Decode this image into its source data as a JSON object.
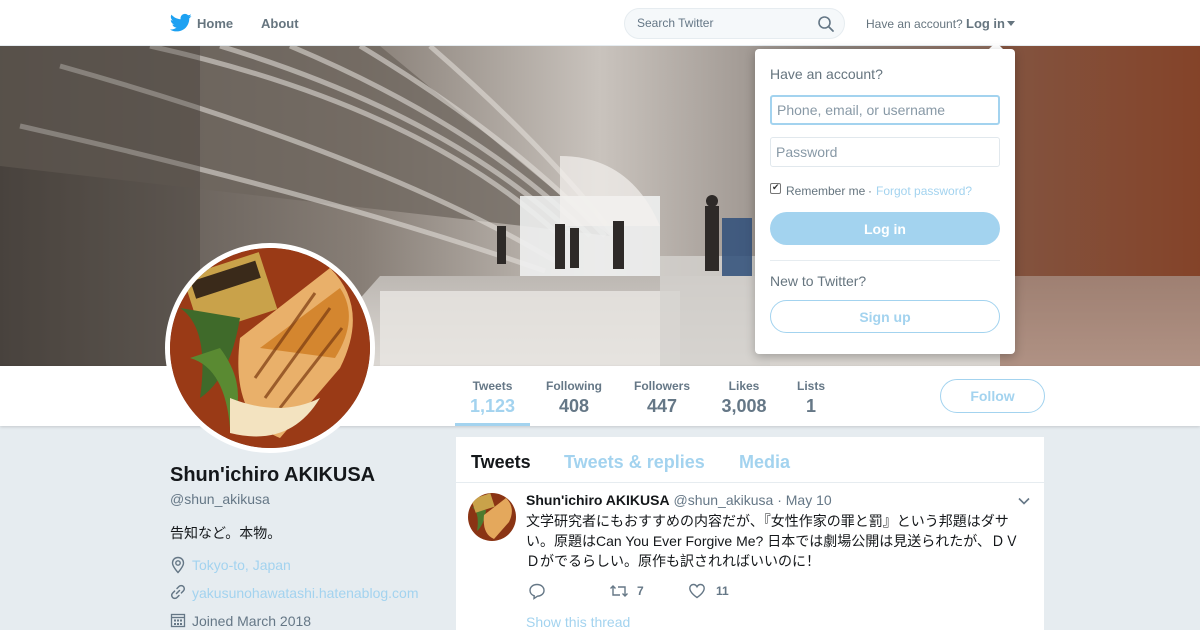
{
  "nav": {
    "home": "Home",
    "about": "About",
    "search_placeholder": "Search Twitter",
    "have_account": "Have an account?",
    "login": "Log in"
  },
  "stats": [
    {
      "label": "Tweets",
      "value": "1,123"
    },
    {
      "label": "Following",
      "value": "408"
    },
    {
      "label": "Followers",
      "value": "447"
    },
    {
      "label": "Likes",
      "value": "3,008"
    },
    {
      "label": "Lists",
      "value": "1"
    }
  ],
  "follow_label": "Follow",
  "profile": {
    "name": "Shun'ichiro AKIKUSA",
    "handle": "@shun_akikusa",
    "bio": "告知など。本物。",
    "location": "Tokyo-to, Japan",
    "website": "yakusunohawatashi.hatenablog.com",
    "joined": "Joined March 2018"
  },
  "timeline": {
    "tabs": [
      "Tweets",
      "Tweets & replies",
      "Media"
    ],
    "tweet": {
      "name": "Shun'ichiro AKIKUSA",
      "handle": "@shun_akikusa",
      "separator": "·",
      "date": "May 10",
      "text": "文学研究者にもおすすめの内容だが、『女性作家の罪と罰』という邦題はダサい。原題はCan You Ever Forgive Me? 日本では劇場公開は見送られたが、ＤＶＤがでるらしい。原作も訳されればいいのに！",
      "retweets": "7",
      "likes": "11",
      "show_thread": "Show this thread"
    }
  },
  "login_dropdown": {
    "title": "Have an account?",
    "username_placeholder": "Phone, email, or username",
    "password_placeholder": "Password",
    "remember_me": "Remember me",
    "separator": "·",
    "forgot_password": "Forgot password?",
    "login_button": "Log in",
    "new_to_twitter": "New to Twitter?",
    "signup_button": "Sign up"
  },
  "colors": {
    "accent_light": "#a3d3ef",
    "text_secondary": "#657786",
    "brand_blue": "#1da1f2"
  },
  "icons": {
    "logo": "twitter-bird-icon",
    "search": "search-icon",
    "location": "location-pin-icon",
    "link": "link-icon",
    "calendar": "calendar-icon",
    "reply": "reply-icon",
    "retweet": "retweet-icon",
    "like": "heart-icon",
    "more": "chevron-down-icon"
  }
}
